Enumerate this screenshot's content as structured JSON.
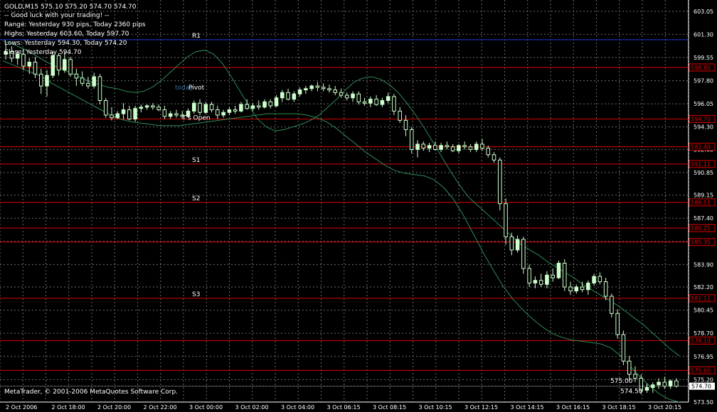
{
  "header": {
    "symbol_line": "GOLD,M15  575.10 575.20 574.70 574.70",
    "comment_lines": [
      "-- Good luck with your trading! --",
      "Range: Yesterday 930 pips, Today 2360 pips",
      "Highs: Yesterday 603.60, Today 597.70",
      "Lows: Yesterday 594.30, Today 574.20",
      "Close: Yesterday 594.70"
    ]
  },
  "copyright": "MetaTrader, © 2001-2006 MetaQuotes Software Corp.",
  "colors": {
    "background": "#000000",
    "grid": "#6b6b6b",
    "bull_candle": "#ccffcc",
    "bear_candle": "#006400",
    "level_line": "#e00000",
    "band_line": "#2e8b57",
    "text": "#ffffff"
  },
  "chart_data": {
    "type": "candlestick",
    "ylim": [
      573.5,
      603.9
    ],
    "grid": true,
    "y_ticks": [
      "603.05",
      "601.30",
      "599.55",
      "597.80",
      "596.05",
      "594.30",
      "592.60",
      "590.85",
      "589.15",
      "587.40",
      "585.65",
      "583.90",
      "582.20",
      "580.45",
      "578.70",
      "576.95",
      "575.20",
      "573.50"
    ],
    "x_ticks": [
      "2 Oct 2006",
      "2 Oct 18:00",
      "2 Oct 20:00",
      "2 Oct 22:00",
      "3 Oct 00:00",
      "3 Oct 02:00",
      "3 Oct 04:00",
      "3 Oct 06:15",
      "3 Oct 08:15",
      "3 Oct 10:15",
      "3 Oct 12:15",
      "3 Oct 14:15",
      "3 Oct 16:15",
      "3 Oct 18:15",
      "3 Oct 20:15"
    ],
    "levels": [
      {
        "name": "R1",
        "value": 600.9,
        "color": "#1f3bd6",
        "label_box": false
      },
      {
        "name": "",
        "value": 598.8,
        "color": "#e00000",
        "label_box": true,
        "price_label": "598.80"
      },
      {
        "name": "",
        "value": 594.9,
        "color": "#e00000",
        "label_box": true,
        "price_label": "594.70"
      },
      {
        "name": "",
        "value": 592.8,
        "color": "#e00000",
        "label_box": true,
        "price_label": "592.40"
      },
      {
        "name": "S1",
        "value": 591.5,
        "color": "#e00000",
        "label_box": true,
        "price_label": "591.11"
      },
      {
        "name": "S2",
        "value": 588.6,
        "color": "#e00000",
        "label_box": true,
        "price_label": "588.51"
      },
      {
        "name": "",
        "value": 586.65,
        "color": "#e00000",
        "label_box": true,
        "price_label": "586.25"
      },
      {
        "name": "",
        "value": 585.6,
        "color": "#e00000",
        "label_box": true,
        "price_label": "585.35"
      },
      {
        "name": "S3",
        "value": 581.35,
        "color": "#e00000",
        "label_box": true,
        "price_label": "581.12"
      },
      {
        "name": "",
        "value": 578.15,
        "color": "#e00000",
        "label_box": true,
        "price_label": "578.10"
      },
      {
        "name": "",
        "value": 575.9,
        "color": "#e00000",
        "label_box": true,
        "price_label": "575.60"
      }
    ],
    "labels": [
      {
        "text": "Pivot",
        "value": 597.3
      },
      {
        "text": "T's Open",
        "value": 595.0
      },
      {
        "text": "today",
        "value": 597.3
      }
    ],
    "current_price": "574.70",
    "bid_ask": [
      "575.00",
      "574.50"
    ],
    "candles": [
      {
        "o": 599.8,
        "h": 600.6,
        "l": 599.4,
        "c": 600.0
      },
      {
        "o": 600.0,
        "h": 600.4,
        "l": 599.2,
        "c": 599.5
      },
      {
        "o": 599.5,
        "h": 600.1,
        "l": 599.0,
        "c": 599.8
      },
      {
        "o": 599.8,
        "h": 600.2,
        "l": 598.6,
        "c": 598.9
      },
      {
        "o": 598.9,
        "h": 599.5,
        "l": 598.3,
        "c": 599.2
      },
      {
        "o": 599.2,
        "h": 599.6,
        "l": 598.0,
        "c": 598.3
      },
      {
        "o": 598.3,
        "h": 598.7,
        "l": 596.8,
        "c": 597.4
      },
      {
        "o": 597.4,
        "h": 598.6,
        "l": 596.6,
        "c": 598.2
      },
      {
        "o": 598.2,
        "h": 600.0,
        "l": 598.0,
        "c": 599.7
      },
      {
        "o": 599.7,
        "h": 599.9,
        "l": 598.2,
        "c": 598.6
      },
      {
        "o": 598.6,
        "h": 600.0,
        "l": 598.4,
        "c": 599.4
      },
      {
        "o": 599.4,
        "h": 599.6,
        "l": 598.1,
        "c": 598.3
      },
      {
        "o": 598.3,
        "h": 598.7,
        "l": 597.4,
        "c": 598.0
      },
      {
        "o": 598.0,
        "h": 598.5,
        "l": 597.4,
        "c": 597.6
      },
      {
        "o": 597.6,
        "h": 598.1,
        "l": 597.2,
        "c": 597.4
      },
      {
        "o": 597.4,
        "h": 598.4,
        "l": 597.2,
        "c": 598.1
      },
      {
        "o": 598.1,
        "h": 598.3,
        "l": 596.0,
        "c": 596.3
      },
      {
        "o": 596.3,
        "h": 596.5,
        "l": 595.0,
        "c": 595.2
      },
      {
        "o": 595.2,
        "h": 595.8,
        "l": 594.8,
        "c": 595.0
      },
      {
        "o": 595.0,
        "h": 595.5,
        "l": 594.9,
        "c": 595.3
      },
      {
        "o": 595.3,
        "h": 596.1,
        "l": 594.9,
        "c": 595.6
      },
      {
        "o": 595.6,
        "h": 595.9,
        "l": 594.8,
        "c": 594.9
      },
      {
        "o": 594.9,
        "h": 595.9,
        "l": 594.7,
        "c": 595.7
      },
      {
        "o": 595.7,
        "h": 596.0,
        "l": 595.4,
        "c": 595.8
      },
      {
        "o": 595.8,
        "h": 596.0,
        "l": 595.6,
        "c": 595.9
      },
      {
        "o": 595.9,
        "h": 596.1,
        "l": 595.6,
        "c": 595.8
      },
      {
        "o": 595.8,
        "h": 596.0,
        "l": 595.5,
        "c": 595.6
      },
      {
        "o": 595.6,
        "h": 595.9,
        "l": 594.9,
        "c": 595.1
      },
      {
        "o": 595.1,
        "h": 595.5,
        "l": 594.9,
        "c": 595.3
      },
      {
        "o": 595.3,
        "h": 595.6,
        "l": 595.0,
        "c": 595.2
      },
      {
        "o": 595.2,
        "h": 595.5,
        "l": 594.9,
        "c": 595.1
      },
      {
        "o": 595.1,
        "h": 595.7,
        "l": 595.0,
        "c": 595.5
      },
      {
        "o": 595.5,
        "h": 596.3,
        "l": 595.3,
        "c": 596.1
      },
      {
        "o": 596.1,
        "h": 596.4,
        "l": 595.2,
        "c": 595.4
      },
      {
        "o": 595.4,
        "h": 596.2,
        "l": 595.3,
        "c": 596.0
      },
      {
        "o": 596.0,
        "h": 596.2,
        "l": 595.4,
        "c": 595.6
      },
      {
        "o": 595.6,
        "h": 595.9,
        "l": 594.9,
        "c": 595.2
      },
      {
        "o": 595.2,
        "h": 595.6,
        "l": 595.0,
        "c": 595.4
      },
      {
        "o": 595.4,
        "h": 595.8,
        "l": 595.2,
        "c": 595.6
      },
      {
        "o": 595.6,
        "h": 595.9,
        "l": 595.3,
        "c": 595.5
      },
      {
        "o": 595.5,
        "h": 596.2,
        "l": 595.4,
        "c": 596.0
      },
      {
        "o": 596.0,
        "h": 596.4,
        "l": 595.6,
        "c": 595.7
      },
      {
        "o": 595.7,
        "h": 596.1,
        "l": 595.5,
        "c": 595.9
      },
      {
        "o": 595.9,
        "h": 596.3,
        "l": 595.6,
        "c": 595.8
      },
      {
        "o": 595.8,
        "h": 596.4,
        "l": 595.7,
        "c": 596.2
      },
      {
        "o": 596.2,
        "h": 596.4,
        "l": 595.7,
        "c": 595.9
      },
      {
        "o": 595.9,
        "h": 596.7,
        "l": 595.8,
        "c": 596.5
      },
      {
        "o": 596.5,
        "h": 597.1,
        "l": 596.2,
        "c": 596.9
      },
      {
        "o": 596.9,
        "h": 597.2,
        "l": 596.3,
        "c": 596.4
      },
      {
        "o": 596.4,
        "h": 597.0,
        "l": 596.2,
        "c": 596.8
      },
      {
        "o": 596.8,
        "h": 597.3,
        "l": 596.6,
        "c": 597.1
      },
      {
        "o": 597.1,
        "h": 597.4,
        "l": 596.8,
        "c": 597.2
      },
      {
        "o": 597.2,
        "h": 597.5,
        "l": 597.0,
        "c": 597.4
      },
      {
        "o": 597.4,
        "h": 597.7,
        "l": 597.0,
        "c": 597.3
      },
      {
        "o": 597.3,
        "h": 597.6,
        "l": 597.0,
        "c": 597.2
      },
      {
        "o": 597.2,
        "h": 597.5,
        "l": 596.9,
        "c": 597.1
      },
      {
        "o": 597.1,
        "h": 597.4,
        "l": 596.7,
        "c": 596.9
      },
      {
        "o": 596.9,
        "h": 597.2,
        "l": 596.5,
        "c": 596.7
      },
      {
        "o": 596.7,
        "h": 596.9,
        "l": 596.3,
        "c": 596.5
      },
      {
        "o": 596.5,
        "h": 597.0,
        "l": 596.2,
        "c": 596.8
      },
      {
        "o": 596.8,
        "h": 597.0,
        "l": 596.0,
        "c": 596.2
      },
      {
        "o": 596.2,
        "h": 596.5,
        "l": 595.9,
        "c": 596.1
      },
      {
        "o": 596.1,
        "h": 596.6,
        "l": 595.8,
        "c": 596.4
      },
      {
        "o": 596.4,
        "h": 596.7,
        "l": 595.9,
        "c": 596.0
      },
      {
        "o": 596.0,
        "h": 596.5,
        "l": 595.8,
        "c": 596.3
      },
      {
        "o": 596.3,
        "h": 596.9,
        "l": 596.1,
        "c": 596.6
      },
      {
        "o": 596.6,
        "h": 596.8,
        "l": 595.2,
        "c": 595.5
      },
      {
        "o": 595.5,
        "h": 595.8,
        "l": 594.6,
        "c": 594.8
      },
      {
        "o": 594.8,
        "h": 595.2,
        "l": 593.6,
        "c": 594.1
      },
      {
        "o": 594.1,
        "h": 594.3,
        "l": 592.3,
        "c": 592.6
      },
      {
        "o": 592.6,
        "h": 593.3,
        "l": 592.0,
        "c": 593.0
      },
      {
        "o": 593.0,
        "h": 593.2,
        "l": 592.5,
        "c": 592.7
      },
      {
        "o": 592.7,
        "h": 593.1,
        "l": 592.4,
        "c": 592.9
      },
      {
        "o": 592.9,
        "h": 593.2,
        "l": 592.5,
        "c": 592.6
      },
      {
        "o": 592.6,
        "h": 593.1,
        "l": 592.4,
        "c": 592.9
      },
      {
        "o": 592.9,
        "h": 593.2,
        "l": 592.6,
        "c": 592.8
      },
      {
        "o": 592.8,
        "h": 593.0,
        "l": 592.4,
        "c": 592.5
      },
      {
        "o": 592.5,
        "h": 593.0,
        "l": 592.3,
        "c": 592.9
      },
      {
        "o": 592.9,
        "h": 593.2,
        "l": 592.6,
        "c": 592.8
      },
      {
        "o": 592.8,
        "h": 593.0,
        "l": 592.4,
        "c": 592.6
      },
      {
        "o": 592.6,
        "h": 593.2,
        "l": 592.4,
        "c": 593.0
      },
      {
        "o": 593.0,
        "h": 593.4,
        "l": 592.5,
        "c": 592.7
      },
      {
        "o": 592.7,
        "h": 592.9,
        "l": 592.0,
        "c": 592.2
      },
      {
        "o": 592.2,
        "h": 592.4,
        "l": 591.6,
        "c": 591.8
      },
      {
        "o": 591.8,
        "h": 592.0,
        "l": 588.0,
        "c": 588.5
      },
      {
        "o": 588.5,
        "h": 588.9,
        "l": 585.4,
        "c": 586.0
      },
      {
        "o": 586.0,
        "h": 586.3,
        "l": 584.6,
        "c": 585.0
      },
      {
        "o": 585.0,
        "h": 586.1,
        "l": 584.8,
        "c": 585.8
      },
      {
        "o": 585.8,
        "h": 586.0,
        "l": 583.2,
        "c": 583.6
      },
      {
        "o": 583.6,
        "h": 583.9,
        "l": 582.2,
        "c": 582.5
      },
      {
        "o": 582.5,
        "h": 583.0,
        "l": 582.1,
        "c": 582.7
      },
      {
        "o": 582.7,
        "h": 583.2,
        "l": 582.2,
        "c": 582.4
      },
      {
        "o": 582.4,
        "h": 583.4,
        "l": 582.1,
        "c": 583.1
      },
      {
        "o": 583.1,
        "h": 583.6,
        "l": 582.6,
        "c": 582.9
      },
      {
        "o": 582.9,
        "h": 584.2,
        "l": 582.8,
        "c": 584.0
      },
      {
        "o": 584.0,
        "h": 584.3,
        "l": 581.9,
        "c": 582.2
      },
      {
        "o": 582.2,
        "h": 582.6,
        "l": 581.6,
        "c": 581.9
      },
      {
        "o": 581.9,
        "h": 582.4,
        "l": 581.7,
        "c": 582.2
      },
      {
        "o": 582.2,
        "h": 582.6,
        "l": 581.8,
        "c": 582.0
      },
      {
        "o": 582.0,
        "h": 582.7,
        "l": 581.6,
        "c": 582.5
      },
      {
        "o": 582.5,
        "h": 583.2,
        "l": 582.3,
        "c": 583.0
      },
      {
        "o": 583.0,
        "h": 583.3,
        "l": 582.4,
        "c": 582.6
      },
      {
        "o": 582.6,
        "h": 582.9,
        "l": 581.2,
        "c": 581.5
      },
      {
        "o": 581.5,
        "h": 581.7,
        "l": 579.9,
        "c": 580.2
      },
      {
        "o": 580.2,
        "h": 580.5,
        "l": 578.3,
        "c": 578.6
      },
      {
        "o": 578.6,
        "h": 578.9,
        "l": 576.3,
        "c": 576.6
      },
      {
        "o": 576.6,
        "h": 577.0,
        "l": 575.1,
        "c": 575.6
      },
      {
        "o": 575.6,
        "h": 576.2,
        "l": 575.0,
        "c": 575.3
      },
      {
        "o": 575.3,
        "h": 575.6,
        "l": 574.1,
        "c": 574.4
      },
      {
        "o": 574.4,
        "h": 574.9,
        "l": 574.2,
        "c": 574.6
      },
      {
        "o": 574.6,
        "h": 575.0,
        "l": 574.2,
        "c": 574.8
      },
      {
        "o": 574.8,
        "h": 575.3,
        "l": 574.5,
        "c": 575.0
      },
      {
        "o": 575.0,
        "h": 575.4,
        "l": 574.5,
        "c": 574.7
      },
      {
        "o": 574.7,
        "h": 575.2,
        "l": 574.5,
        "c": 575.1
      },
      {
        "o": 575.1,
        "h": 575.3,
        "l": 574.6,
        "c": 574.7
      }
    ],
    "band_upper": [
      600.8,
      600.6,
      600.3,
      600.0,
      599.6,
      599.2,
      598.9,
      598.6,
      598.3,
      598.0,
      597.7,
      597.5,
      597.3,
      597.2,
      597.0,
      596.9,
      597.0,
      597.3,
      597.8,
      598.4,
      599.0,
      599.6,
      600.0,
      600.1,
      599.8,
      599.1,
      598.1,
      597.0,
      595.9,
      594.9,
      594.3,
      594.0,
      594.1,
      594.3,
      594.5,
      594.8,
      595.2,
      595.8,
      596.4,
      597.1,
      597.7,
      598.0,
      598.1,
      597.9,
      597.5,
      596.9,
      596.1,
      595.2,
      594.2,
      593.1,
      592.0,
      590.9,
      589.9,
      589.0,
      588.4,
      587.8,
      587.2,
      586.6,
      586.0,
      585.4,
      585.0,
      584.6,
      584.1,
      583.7,
      583.3,
      582.9,
      582.4,
      582.0,
      581.6,
      581.2,
      580.8,
      580.3,
      579.8,
      579.3,
      578.7,
      578.1,
      577.5,
      577.0
    ],
    "band_lower": [
      599.3,
      599.0,
      598.7,
      598.4,
      598.1,
      597.6,
      597.2,
      596.8,
      596.4,
      596.0,
      595.6,
      595.2,
      594.9,
      594.7,
      594.6,
      594.5,
      594.4,
      594.4,
      594.4,
      594.5,
      594.6,
      594.7,
      594.8,
      594.9,
      595.0,
      595.1,
      595.2,
      595.3,
      595.3,
      595.3,
      595.3,
      595.2,
      595.0,
      594.7,
      594.2,
      593.6,
      593.0,
      592.4,
      591.9,
      591.4,
      591.0,
      590.8,
      590.7,
      590.6,
      590.3,
      589.7,
      588.8,
      587.6,
      586.2,
      584.8,
      583.5,
      582.3,
      581.3,
      580.5,
      579.8,
      579.2,
      578.7,
      578.4,
      578.2,
      578.1,
      578.0,
      577.9,
      577.6,
      577.0,
      576.2,
      575.4,
      574.7,
      574.1,
      573.7,
      573.5
    ]
  }
}
